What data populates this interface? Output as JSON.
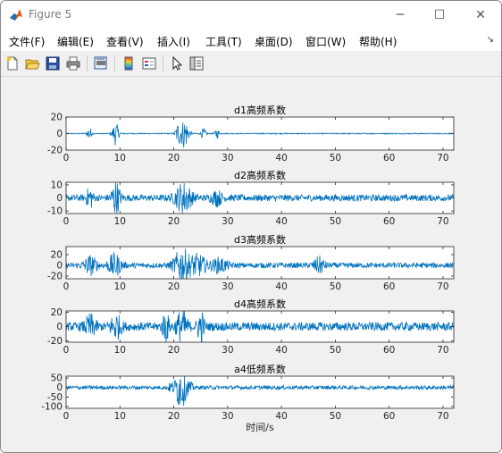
{
  "window": {
    "title": "Figure 5"
  },
  "window_controls": {
    "minimize": "─",
    "maximize": "☐",
    "close": "✕"
  },
  "menu": [
    {
      "label": "文件(F)"
    },
    {
      "label": "编辑(E)"
    },
    {
      "label": "查看(V)"
    },
    {
      "label": "插入(I)"
    },
    {
      "label": "工具(T)"
    },
    {
      "label": "桌面(D)"
    },
    {
      "label": "窗口(W)"
    },
    {
      "label": "帮助(H)"
    }
  ],
  "toolbar_icons": [
    "new-file-icon",
    "open-folder-icon",
    "save-icon",
    "print-icon",
    "print-preview-icon",
    "colorbar-icon",
    "legend-icon",
    "pointer-icon",
    "property-editor-icon"
  ],
  "colors": {
    "line": "#0072bd",
    "axes_bg": "#ffffff",
    "figure_bg": "#f0f0f0"
  },
  "chart_data": [
    {
      "type": "line",
      "title": "d1高频系数",
      "xlim": [
        0,
        72
      ],
      "ylim": [
        -20,
        20
      ],
      "xticks": [
        0,
        10,
        20,
        30,
        40,
        50,
        60,
        70
      ],
      "yticks": [
        20,
        0,
        -20
      ],
      "series": [
        {
          "x_start": 0,
          "x_end": 72,
          "noise_amplitude": 0.6,
          "bursts": [
            {
              "x": 4.3,
              "amp": 9,
              "width": 0.4
            },
            {
              "x": 9.2,
              "amp": 14,
              "width": 0.6
            },
            {
              "x": 20.8,
              "amp": 12,
              "width": 0.5
            },
            {
              "x": 22.0,
              "amp": 18,
              "width": 0.8
            },
            {
              "x": 25.5,
              "amp": 6,
              "width": 0.5
            },
            {
              "x": 28.0,
              "amp": 6,
              "width": 0.4
            }
          ]
        }
      ]
    },
    {
      "type": "line",
      "title": "d2高频系数",
      "xlim": [
        0,
        72
      ],
      "ylim": [
        -12,
        12
      ],
      "xticks": [
        0,
        10,
        20,
        30,
        40,
        50,
        60,
        70
      ],
      "yticks": [
        10,
        0,
        -10
      ],
      "series": [
        {
          "x_start": 0,
          "x_end": 72,
          "noise_amplitude": 2.5,
          "bursts": [
            {
              "x": 4.4,
              "amp": 8,
              "width": 0.6
            },
            {
              "x": 9.2,
              "amp": 12,
              "width": 0.8
            },
            {
              "x": 21.8,
              "amp": 11,
              "width": 1.5
            },
            {
              "x": 28.0,
              "amp": 5,
              "width": 1.0
            }
          ]
        }
      ]
    },
    {
      "type": "line",
      "title": "d3高频系数",
      "xlim": [
        0,
        72
      ],
      "ylim": [
        -25,
        35
      ],
      "xticks": [
        0,
        10,
        20,
        30,
        40,
        50,
        60,
        70
      ],
      "yticks": [
        20,
        0,
        -20
      ],
      "series": [
        {
          "x_start": 0,
          "x_end": 72,
          "noise_amplitude": 5,
          "bursts": [
            {
              "x": 4.5,
              "amp": 16,
              "width": 1.2
            },
            {
              "x": 9.0,
              "amp": 20,
              "width": 1.2
            },
            {
              "x": 21.5,
              "amp": 30,
              "width": 1.5
            },
            {
              "x": 24.5,
              "amp": 18,
              "width": 1.5
            },
            {
              "x": 28.5,
              "amp": 12,
              "width": 1.5
            },
            {
              "x": 47.0,
              "amp": 14,
              "width": 1.0
            }
          ]
        }
      ]
    },
    {
      "type": "line",
      "title": "d4高频系数",
      "xlim": [
        0,
        72
      ],
      "ylim": [
        -22,
        22
      ],
      "xticks": [
        0,
        10,
        20,
        30,
        40,
        50,
        60,
        70
      ],
      "yticks": [
        20,
        0,
        -20
      ],
      "series": [
        {
          "x_start": 0,
          "x_end": 72,
          "noise_amplitude": 6,
          "bursts": [
            {
              "x": 4.5,
              "amp": 14,
              "width": 1.0
            },
            {
              "x": 9.2,
              "amp": 16,
              "width": 1.0
            },
            {
              "x": 18.5,
              "amp": 20,
              "width": 0.6
            },
            {
              "x": 21.5,
              "amp": 22,
              "width": 1.0
            },
            {
              "x": 25.0,
              "amp": 22,
              "width": 0.6
            }
          ]
        }
      ]
    },
    {
      "type": "line",
      "title": "a4低频系数",
      "xlabel": "时间/s",
      "xlim": [
        0,
        72
      ],
      "ylim": [
        -110,
        60
      ],
      "xticks": [
        0,
        10,
        20,
        30,
        40,
        50,
        60,
        70
      ],
      "yticks": [
        50,
        0,
        -50,
        -100
      ],
      "series": [
        {
          "x_start": 0,
          "x_end": 72,
          "noise_amplitude": 10,
          "bursts": [
            {
              "x": 19.6,
              "amp": 25,
              "width": 0.6
            },
            {
              "x": 20.7,
              "amp": 60,
              "width": 0.5
            },
            {
              "x": 21.6,
              "amp": 95,
              "width": 0.8
            },
            {
              "x": 23.0,
              "amp": 25,
              "width": 0.6
            }
          ]
        }
      ]
    }
  ]
}
